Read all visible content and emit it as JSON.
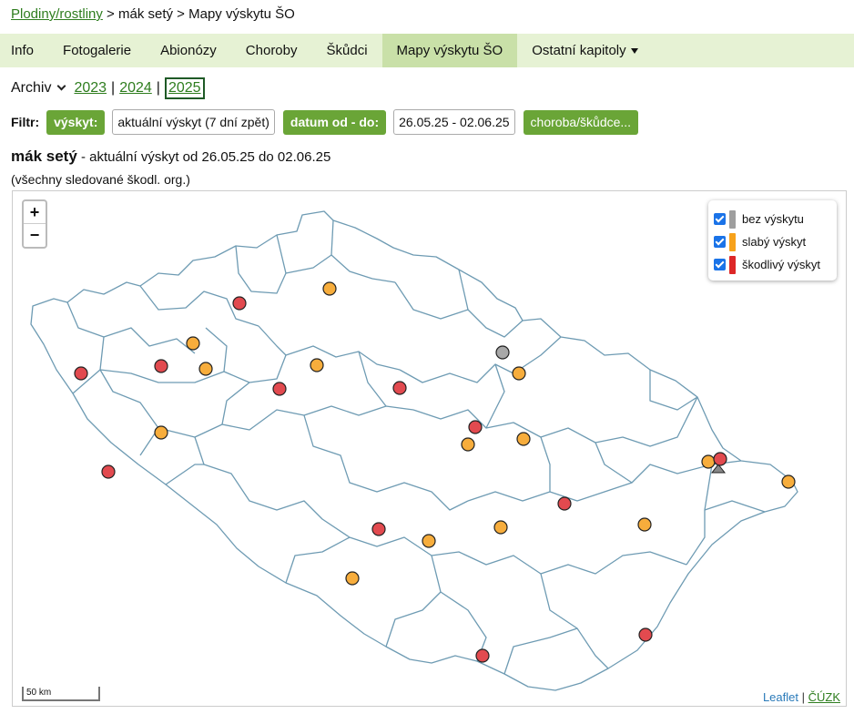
{
  "breadcrumb": {
    "root": "Plodiny/rostliny",
    "sep1": " > ",
    "crop": "mák setý",
    "sep2": " > ",
    "current": "Mapy výskytu ŠO"
  },
  "tabs": [
    {
      "label": "Info"
    },
    {
      "label": "Fotogalerie"
    },
    {
      "label": "Abionózy"
    },
    {
      "label": "Choroby"
    },
    {
      "label": "Škůdci"
    },
    {
      "label": "Mapy výskytu ŠO"
    },
    {
      "label": "Ostatní kapitoly"
    }
  ],
  "archive": {
    "select": "Archiv",
    "years": [
      "2023",
      "2024",
      "2025"
    ],
    "sep": "|"
  },
  "filter": {
    "label": "Filtr:",
    "occurrence_btn": "výskyt:",
    "occurrence_value": "aktuální výskyt (7 dní zpět)",
    "date_btn": "datum od - do:",
    "date_value": "26.05.25 - 02.06.25",
    "disease_btn": "choroba/škůdce..."
  },
  "title": {
    "crop": "mák setý",
    "rest": " - aktuální výskyt od 26.05.25 do 02.06.25"
  },
  "subtitle": "(všechny sledované škodl. org.)",
  "map": {
    "zoom_in": "+",
    "zoom_out": "−",
    "legend": [
      {
        "label": "bez výskytu",
        "color": "#9e9e9e"
      },
      {
        "label": "slabý výskyt",
        "color": "#f7a21b"
      },
      {
        "label": "škodlivý výskyt",
        "color": "#dd2727"
      }
    ],
    "scale_label": "50 km",
    "attrib_leaflet": "Leaflet",
    "attrib_sep": " | ",
    "attrib_cuzk": "ČÚZK",
    "marker_colors": {
      "none": "#a8a8a8",
      "weak": "#f7ad3c",
      "harmful": "#e24a4f"
    }
  }
}
